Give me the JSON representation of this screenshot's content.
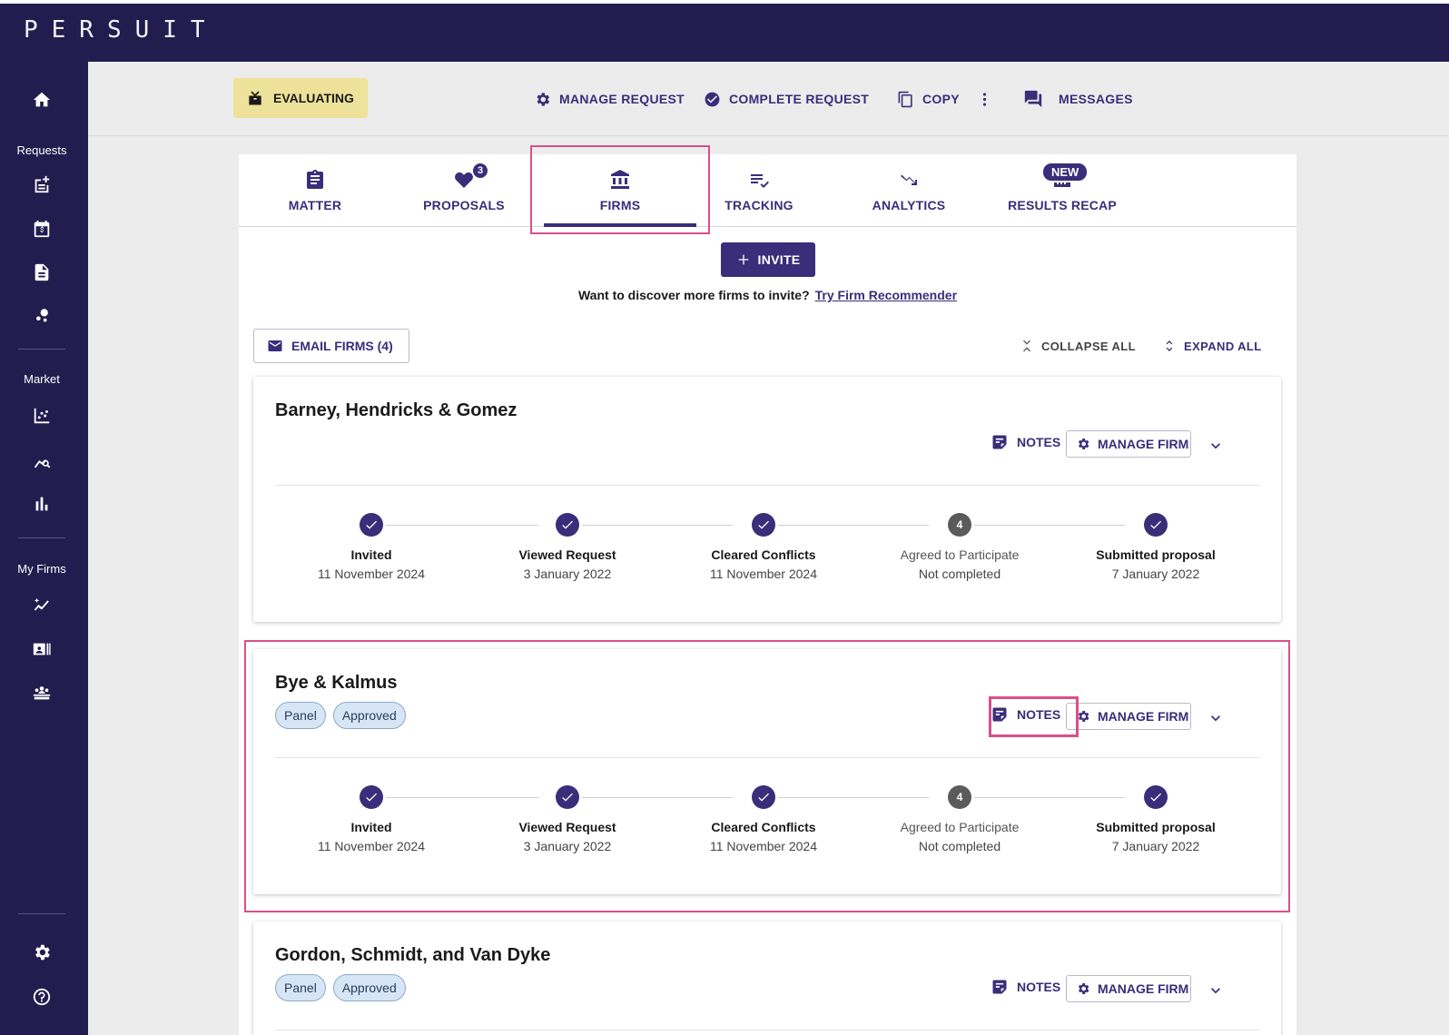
{
  "app": {
    "logo": "PERSUIT"
  },
  "sidebar": {
    "sections": [
      "Requests",
      "Market",
      "My Firms"
    ],
    "icons": [
      "home-icon",
      "new-request-icon",
      "calendar-dollar-icon",
      "document-icon",
      "nodes-icon",
      "scatter-chart-icon",
      "market-search-icon",
      "bar-chart-icon",
      "sparkle-trend-icon",
      "contact-card-icon",
      "team-icon",
      "gear-icon",
      "help-icon"
    ]
  },
  "header": {
    "status": "EVALUATING",
    "actions": [
      "MANAGE REQUEST",
      "COMPLETE REQUEST",
      "COPY",
      "MESSAGES"
    ]
  },
  "tabs": [
    {
      "label": "MATTER"
    },
    {
      "label": "PROPOSALS",
      "count": "3"
    },
    {
      "label": "FIRMS"
    },
    {
      "label": "TRACKING"
    },
    {
      "label": "ANALYTICS"
    },
    {
      "label": "RESULTS RECAP",
      "badge": "NEW"
    }
  ],
  "active_tab": "FIRMS",
  "invite": {
    "label": "INVITE"
  },
  "discover": {
    "text": "Want to discover more firms to invite?",
    "link": "Try Firm Recommender"
  },
  "toolbar": {
    "email": "EMAIL FIRMS (4)",
    "collapse": "COLLAPSE ALL",
    "expand": "EXPAND ALL"
  },
  "firm_actions": {
    "notes": "NOTES",
    "manage": "MANAGE FIRM"
  },
  "steps": [
    {
      "label": "Invited",
      "status": "complete"
    },
    {
      "label": "Viewed Request",
      "status": "complete"
    },
    {
      "label": "Cleared Conflicts",
      "status": "complete"
    },
    {
      "label": "Agreed to Participate",
      "status": "pending",
      "number": "4"
    },
    {
      "label": "Submitted proposal",
      "status": "complete"
    }
  ],
  "firms": [
    {
      "name": "Barney, Hendricks & Gomez",
      "tags": [],
      "dates": [
        "11 November 2024",
        "3 January 2022",
        "11 November 2024",
        "Not completed",
        "7 January 2022"
      ]
    },
    {
      "name": "Bye & Kalmus",
      "tags": [
        "Panel",
        "Approved"
      ],
      "dates": [
        "11 November 2024",
        "3 January 2022",
        "11 November 2024",
        "Not completed",
        "7 January 2022"
      ]
    },
    {
      "name": "Gordon, Schmidt, and Van Dyke",
      "tags": [
        "Panel",
        "Approved"
      ],
      "dates": []
    }
  ]
}
